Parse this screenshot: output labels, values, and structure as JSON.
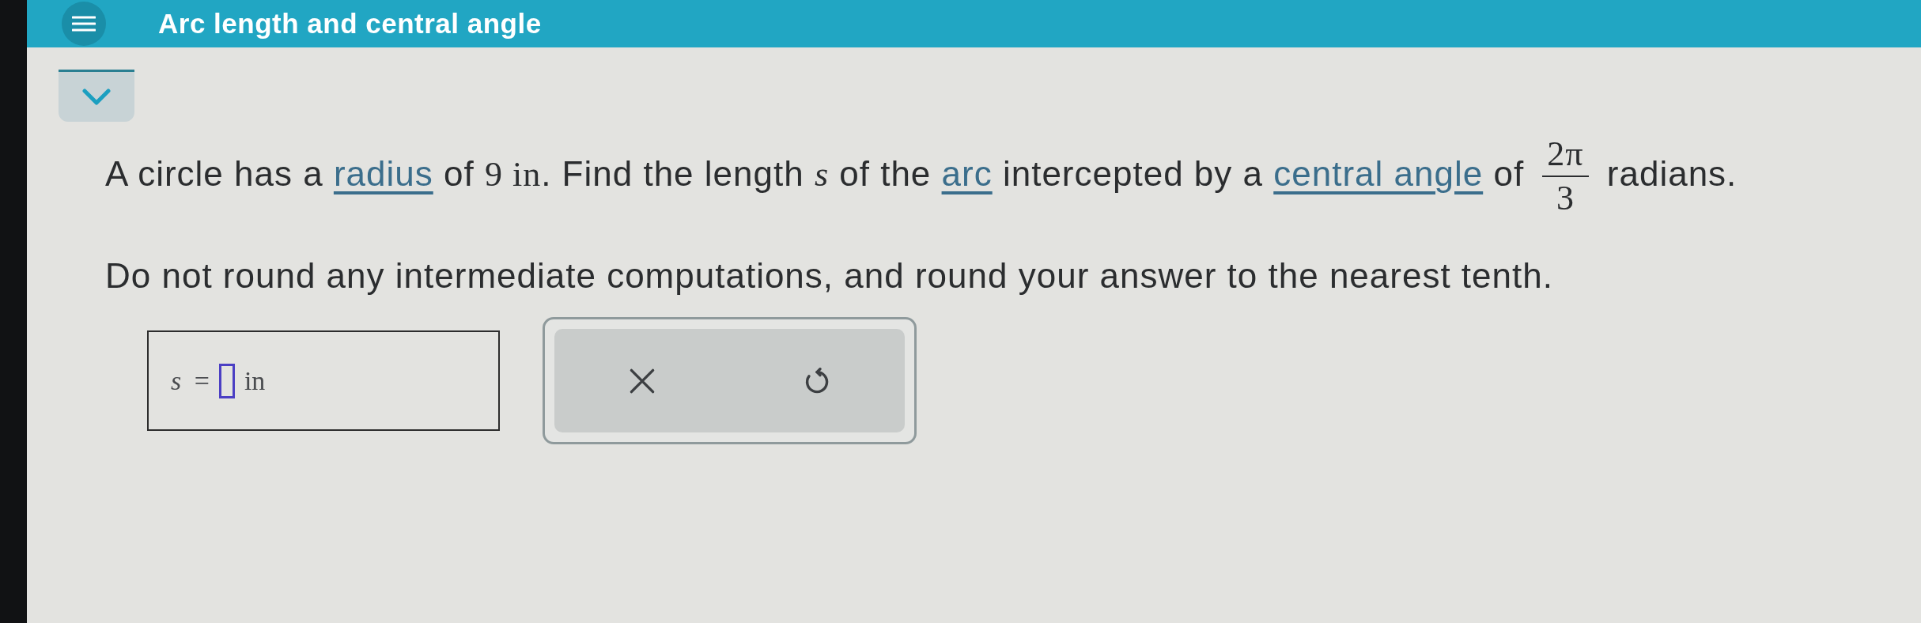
{
  "header": {
    "title": "Arc length and central angle"
  },
  "question": {
    "parts": [
      {
        "kind": "text",
        "text": "A circle has a "
      },
      {
        "kind": "link",
        "text": "radius"
      },
      {
        "kind": "text",
        "text": " of "
      },
      {
        "kind": "math",
        "text": "9 in"
      },
      {
        "kind": "text",
        "text": ". Find the length "
      },
      {
        "kind": "variable",
        "text": "s"
      },
      {
        "kind": "text",
        "text": " of the "
      },
      {
        "kind": "link",
        "text": "arc"
      },
      {
        "kind": "text",
        "text": " intercepted by a "
      },
      {
        "kind": "link",
        "text": "central angle"
      },
      {
        "kind": "text",
        "text": " of "
      },
      {
        "kind": "fraction",
        "numerator": "2π",
        "denominator": "3"
      },
      {
        "kind": "text",
        "text": " radians."
      }
    ]
  },
  "instruction": "Do not round any intermediate computations, and round your answer to the nearest tenth.",
  "answer": {
    "label": "*s* =",
    "unit": "in"
  },
  "actions": [
    {
      "kind": "clear"
    },
    {
      "kind": "undo"
    }
  ]
}
